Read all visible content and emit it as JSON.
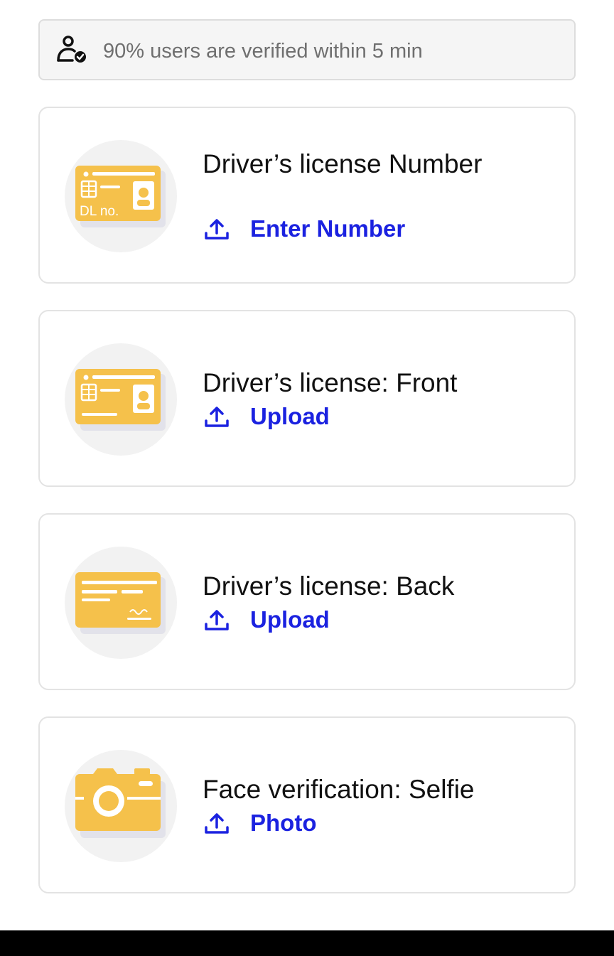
{
  "banner": {
    "icon": "user-verified-icon",
    "text": "90% users are verified within 5 min"
  },
  "cards": [
    {
      "title": "Driver’s license Number",
      "action_label": "Enter Number",
      "icon": "license-number-card-icon",
      "icon_text": "DL no."
    },
    {
      "title": "Driver’s license: Front",
      "action_label": "Upload",
      "icon": "license-front-card-icon"
    },
    {
      "title": "Driver’s license: Back",
      "action_label": "Upload",
      "icon": "license-back-card-icon"
    },
    {
      "title": "Face verification: Selfie",
      "action_label": "Photo",
      "icon": "camera-icon"
    }
  ],
  "colors": {
    "accent": "#1b22e0",
    "card_yellow": "#f5c14b",
    "icon_circle": "#f2f2f2",
    "banner_bg": "#f5f5f5"
  }
}
